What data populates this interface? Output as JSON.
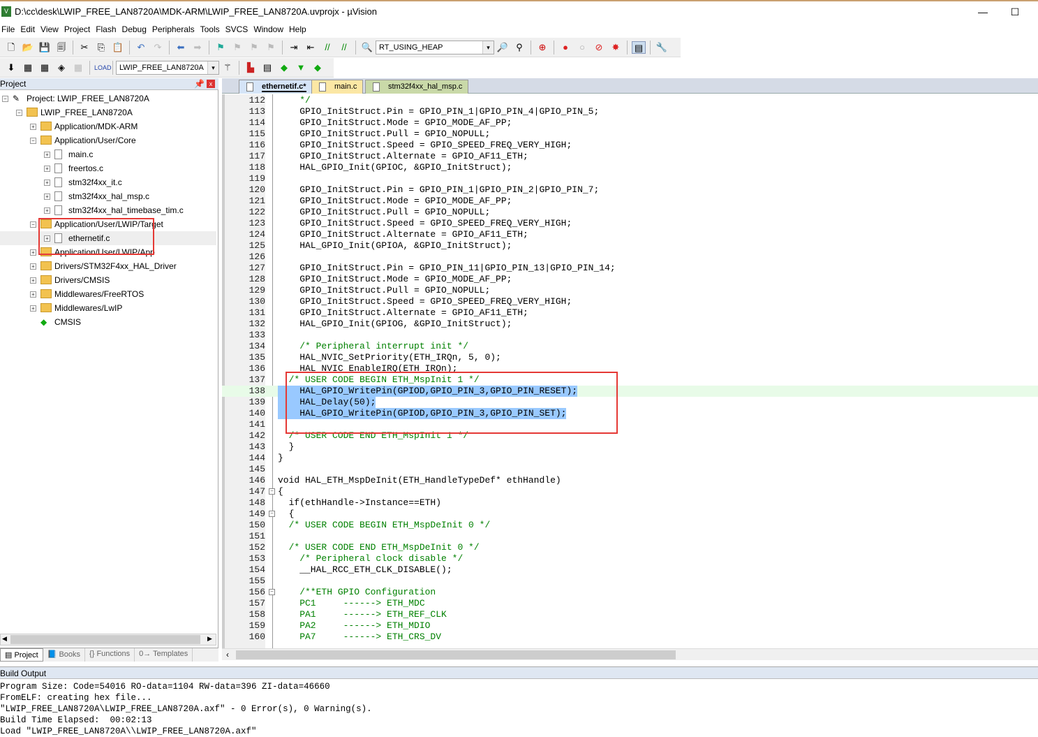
{
  "window": {
    "title": "D:\\cc\\desk\\LWIP_FREE_LAN8720A\\MDK-ARM\\LWIP_FREE_LAN8720A.uvprojx - µVision",
    "minimize": "—",
    "maximize": "☐"
  },
  "menu": [
    "File",
    "Edit",
    "View",
    "Project",
    "Flash",
    "Debug",
    "Peripherals",
    "Tools",
    "SVCS",
    "Window",
    "Help"
  ],
  "toolbar1": {
    "find_combo": "RT_USING_HEAP"
  },
  "toolbar2": {
    "target_combo": "LWIP_FREE_LAN8720A"
  },
  "project": {
    "header": "Project",
    "tree": [
      {
        "label": "Project: LWIP_FREE_LAN8720A",
        "level": 0,
        "type": "project",
        "expanded": true
      },
      {
        "label": "LWIP_FREE_LAN8720A",
        "level": 1,
        "type": "target",
        "expanded": true
      },
      {
        "label": "Application/MDK-ARM",
        "level": 2,
        "type": "folder",
        "expanded": false
      },
      {
        "label": "Application/User/Core",
        "level": 2,
        "type": "folder",
        "expanded": true
      },
      {
        "label": "main.c",
        "level": 3,
        "type": "file"
      },
      {
        "label": "freertos.c",
        "level": 3,
        "type": "file"
      },
      {
        "label": "stm32f4xx_it.c",
        "level": 3,
        "type": "file"
      },
      {
        "label": "stm32f4xx_hal_msp.c",
        "level": 3,
        "type": "file"
      },
      {
        "label": "stm32f4xx_hal_timebase_tim.c",
        "level": 3,
        "type": "file"
      },
      {
        "label": "Application/User/LWIP/Target",
        "level": 2,
        "type": "folder",
        "expanded": true
      },
      {
        "label": "ethernetif.c",
        "level": 3,
        "type": "file",
        "selected": true
      },
      {
        "label": "Application/User/LWIP/App",
        "level": 2,
        "type": "folder",
        "expanded": false
      },
      {
        "label": "Drivers/STM32F4xx_HAL_Driver",
        "level": 2,
        "type": "folder",
        "expanded": false
      },
      {
        "label": "Drivers/CMSIS",
        "level": 2,
        "type": "folder",
        "expanded": false
      },
      {
        "label": "Middlewares/FreeRTOS",
        "level": 2,
        "type": "folder",
        "expanded": false
      },
      {
        "label": "Middlewares/LwIP",
        "level": 2,
        "type": "folder",
        "expanded": false
      },
      {
        "label": "CMSIS",
        "level": 2,
        "type": "component"
      }
    ],
    "tabs": [
      "Project",
      "Books",
      "Functions",
      "Templates"
    ]
  },
  "editor": {
    "tabs": [
      {
        "label": "ethernetif.c*",
        "active": true,
        "color": "#d5e4f7"
      },
      {
        "label": "main.c",
        "color": "#fbe7a4"
      },
      {
        "label": "stm32f4xx_hal_msp.c",
        "color": "#c9d9a8"
      }
    ],
    "lines": [
      {
        "n": "112",
        "t": "    */",
        "c": 1
      },
      {
        "n": "113",
        "t": "    GPIO_InitStruct.Pin = GPIO_PIN_1|GPIO_PIN_4|GPIO_PIN_5;"
      },
      {
        "n": "114",
        "t": "    GPIO_InitStruct.Mode = GPIO_MODE_AF_PP;"
      },
      {
        "n": "115",
        "t": "    GPIO_InitStruct.Pull = GPIO_NOPULL;"
      },
      {
        "n": "116",
        "t": "    GPIO_InitStruct.Speed = GPIO_SPEED_FREQ_VERY_HIGH;"
      },
      {
        "n": "117",
        "t": "    GPIO_InitStruct.Alternate = GPIO_AF11_ETH;"
      },
      {
        "n": "118",
        "t": "    HAL_GPIO_Init(GPIOC, &GPIO_InitStruct);"
      },
      {
        "n": "119",
        "t": ""
      },
      {
        "n": "120",
        "t": "    GPIO_InitStruct.Pin = GPIO_PIN_1|GPIO_PIN_2|GPIO_PIN_7;"
      },
      {
        "n": "121",
        "t": "    GPIO_InitStruct.Mode = GPIO_MODE_AF_PP;"
      },
      {
        "n": "122",
        "t": "    GPIO_InitStruct.Pull = GPIO_NOPULL;"
      },
      {
        "n": "123",
        "t": "    GPIO_InitStruct.Speed = GPIO_SPEED_FREQ_VERY_HIGH;"
      },
      {
        "n": "124",
        "t": "    GPIO_InitStruct.Alternate = GPIO_AF11_ETH;"
      },
      {
        "n": "125",
        "t": "    HAL_GPIO_Init(GPIOA, &GPIO_InitStruct);"
      },
      {
        "n": "126",
        "t": ""
      },
      {
        "n": "127",
        "t": "    GPIO_InitStruct.Pin = GPIO_PIN_11|GPIO_PIN_13|GPIO_PIN_14;"
      },
      {
        "n": "128",
        "t": "    GPIO_InitStruct.Mode = GPIO_MODE_AF_PP;"
      },
      {
        "n": "129",
        "t": "    GPIO_InitStruct.Pull = GPIO_NOPULL;"
      },
      {
        "n": "130",
        "t": "    GPIO_InitStruct.Speed = GPIO_SPEED_FREQ_VERY_HIGH;"
      },
      {
        "n": "131",
        "t": "    GPIO_InitStruct.Alternate = GPIO_AF11_ETH;"
      },
      {
        "n": "132",
        "t": "    HAL_GPIO_Init(GPIOG, &GPIO_InitStruct);"
      },
      {
        "n": "133",
        "t": ""
      },
      {
        "n": "134",
        "t": "    /* Peripheral interrupt init */",
        "c": 1
      },
      {
        "n": "135",
        "t": "    HAL_NVIC_SetPriority(ETH_IRQn, 5, 0);"
      },
      {
        "n": "136",
        "t": "    HAL_NVIC_EnableIRQ(ETH_IRQn);"
      },
      {
        "n": "137",
        "t": "  /* USER CODE BEGIN ETH_MspInit 1 */",
        "c": 1
      },
      {
        "n": "138",
        "t": "    HAL_GPIO_WritePin(GPIOD,GPIO_PIN_3,GPIO_PIN_RESET);",
        "s": "partial"
      },
      {
        "n": "139",
        "t": "    HAL_Delay(50);",
        "s": "full"
      },
      {
        "n": "140",
        "t": "    HAL_GPIO_WritePin(GPIOD,GPIO_PIN_3,GPIO_PIN_SET);",
        "s": "full"
      },
      {
        "n": "141",
        "t": ""
      },
      {
        "n": "142",
        "t": "  /* USER CODE END ETH_MspInit 1 */",
        "c": 1
      },
      {
        "n": "143",
        "t": "  }"
      },
      {
        "n": "144",
        "t": "}"
      },
      {
        "n": "145",
        "t": ""
      },
      {
        "n": "146",
        "t": "void HAL_ETH_MspDeInit(ETH_HandleTypeDef* ethHandle)"
      },
      {
        "n": "147",
        "t": "{",
        "f": 1
      },
      {
        "n": "148",
        "t": "  if(ethHandle->Instance==ETH)"
      },
      {
        "n": "149",
        "t": "  {",
        "f": 1
      },
      {
        "n": "150",
        "t": "  /* USER CODE BEGIN ETH_MspDeInit 0 */",
        "c": 1
      },
      {
        "n": "151",
        "t": ""
      },
      {
        "n": "152",
        "t": "  /* USER CODE END ETH_MspDeInit 0 */",
        "c": 1
      },
      {
        "n": "153",
        "t": "    /* Peripheral clock disable */",
        "c": 1
      },
      {
        "n": "154",
        "t": "    __HAL_RCC_ETH_CLK_DISABLE();"
      },
      {
        "n": "155",
        "t": ""
      },
      {
        "n": "156",
        "t": "    /**ETH GPIO Configuration",
        "c": 1,
        "f": 1
      },
      {
        "n": "157",
        "t": "    PC1     ------> ETH_MDC",
        "c": 1
      },
      {
        "n": "158",
        "t": "    PA1     ------> ETH_REF_CLK",
        "c": 1
      },
      {
        "n": "159",
        "t": "    PA2     ------> ETH_MDIO",
        "c": 1
      },
      {
        "n": "160",
        "t": "    PA7     ------> ETH_CRS_DV",
        "c": 1
      }
    ]
  },
  "build": {
    "header": "Build Output",
    "lines": [
      "Program Size: Code=54016 RO-data=1104 RW-data=396 ZI-data=46660",
      "FromELF: creating hex file...",
      "\"LWIP_FREE_LAN8720A\\LWIP_FREE_LAN8720A.axf\" - 0 Error(s), 0 Warning(s).",
      "Build Time Elapsed:  00:02:13",
      "Load \"LWIP_FREE_LAN8720A\\\\LWIP_FREE_LAN8720A.axf\""
    ]
  }
}
